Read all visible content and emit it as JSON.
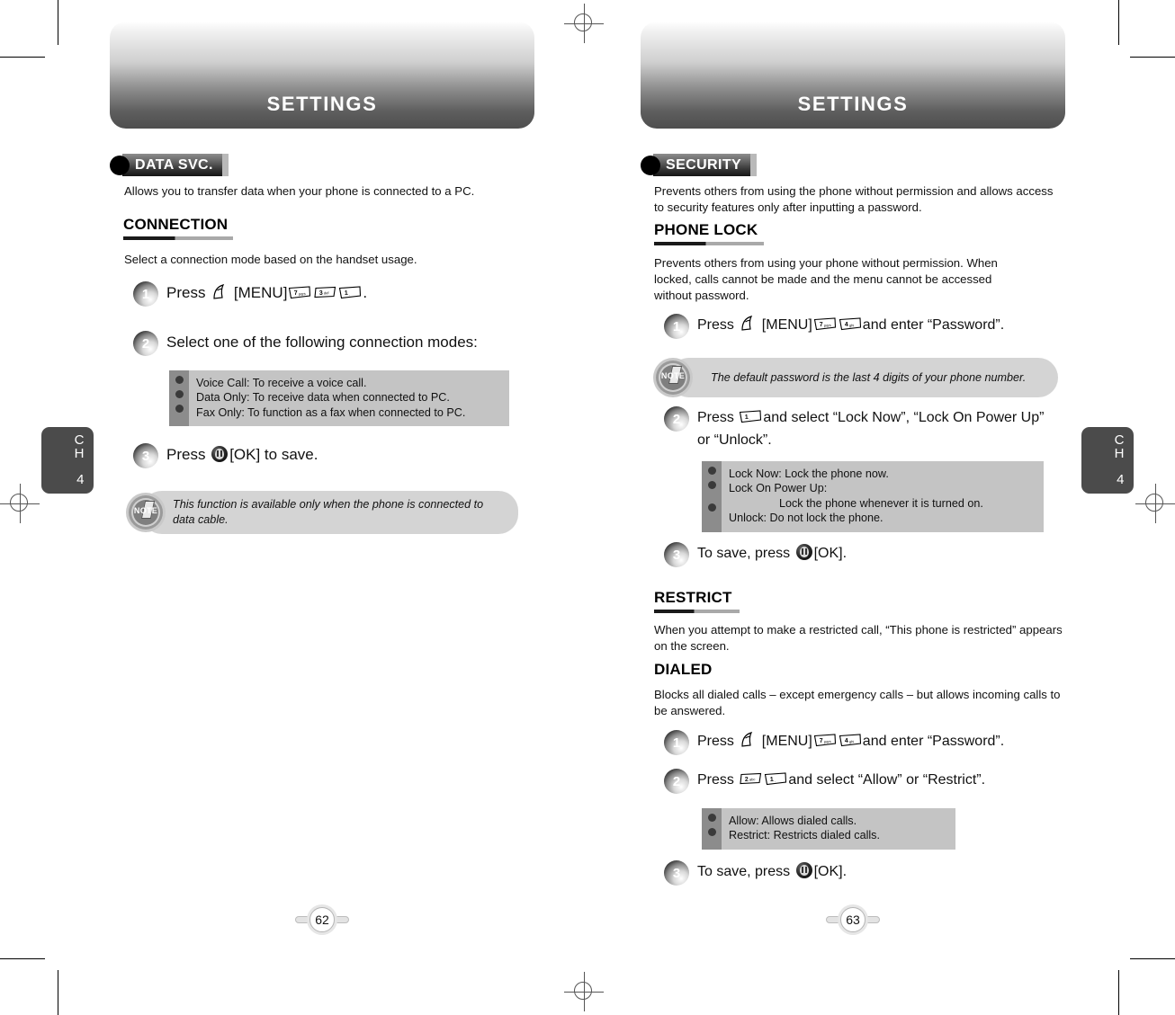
{
  "document": {
    "chapter_tab": {
      "line1": "C",
      "line2": "H",
      "line3": "4"
    }
  },
  "left_page": {
    "banner_title": "SETTINGS",
    "page_number": "62",
    "section": {
      "tag": "DATA SVC.",
      "intro": "Allows you to transfer data when your phone is connected to a PC."
    },
    "subsection": {
      "heading": "CONNECTION",
      "description": "Select a connection mode based on the handset usage."
    },
    "steps": [
      {
        "number": "1",
        "parts": [
          {
            "type": "text",
            "value": "Press "
          },
          {
            "type": "menu-key"
          },
          {
            "type": "text",
            "value": "[MENU]"
          },
          {
            "type": "key",
            "digit": "7",
            "letters": "pqrs"
          },
          {
            "type": "key",
            "digit": "3",
            "letters": "def"
          },
          {
            "type": "key",
            "digit": "1",
            "letters": "."
          },
          {
            "type": "text",
            "value": "."
          }
        ],
        "plain": "Press [MENU] 7 3 1 ."
      },
      {
        "number": "2",
        "plain": "Select one of the following connection modes:"
      },
      {
        "number": "3",
        "plain": "Press [OK] to save.",
        "before_ok": "Press ",
        "after_ok": "[OK] to save."
      }
    ],
    "info_box": {
      "bullets": [
        "Voice Call: To receive a voice call.",
        "Data Only: To receive data when connected to PC.",
        "Fax Only: To function as a fax when connected to PC."
      ]
    },
    "note": {
      "icon_label": "NOTE",
      "text": "This function is available only when the phone is connected to data cable."
    }
  },
  "right_page": {
    "banner_title": "SETTINGS",
    "page_number": "63",
    "section": {
      "tag": "SECURITY",
      "intro": "Prevents others from using the phone without permission and allows access to security features only after inputting a password."
    },
    "phone_lock": {
      "heading": "PHONE LOCK",
      "description": "Prevents others from using your phone without permission. When locked, calls cannot be made and the menu cannot be accessed without password.",
      "step1": {
        "number": "1",
        "before_menu": "Press ",
        "menu_label": "[MENU]",
        "keys": [
          {
            "digit": "7",
            "letters": "pqrs"
          },
          {
            "digit": "4",
            "letters": "ghi"
          }
        ],
        "after_keys": "and enter “Password”."
      },
      "note": {
        "icon_label": "NOTE",
        "text": "The default password is the last 4 digits of your phone number."
      },
      "step2": {
        "number": "2",
        "before_key": "Press ",
        "key": {
          "digit": "1",
          "letters": "."
        },
        "after_key": "and select “Lock Now”, “Lock On Power Up” or “Unlock”."
      },
      "info_box": {
        "bullets": [
          "Lock Now: Lock the phone now.",
          "Lock On Power Up:",
          "Unlock: Do not lock the phone."
        ],
        "indented_line": "Lock the phone whenever it is turned on."
      },
      "step3": {
        "number": "3",
        "before_ok": "To save, press ",
        "after_ok": "[OK]."
      }
    },
    "restrict": {
      "heading": "RESTRICT",
      "description": "When you attempt to make a restricted call, “This phone is restricted” appears on the screen."
    },
    "dialed": {
      "heading": "DIALED",
      "description": "Blocks all dialed calls – except emergency calls – but allows incoming calls to be answered.",
      "step1": {
        "number": "1",
        "before_menu": "Press ",
        "menu_label": "[MENU]",
        "keys": [
          {
            "digit": "7",
            "letters": "pqrs"
          },
          {
            "digit": "4",
            "letters": "ghi"
          }
        ],
        "after_keys": "and enter “Password”."
      },
      "step2": {
        "number": "2",
        "before_keys": "Press ",
        "keys": [
          {
            "digit": "2",
            "letters": "abc"
          },
          {
            "digit": "1",
            "letters": "."
          }
        ],
        "after_keys": "and select “Allow” or “Restrict”."
      },
      "info_box": {
        "bullets": [
          "Allow: Allows dialed calls.",
          "Restrict: Restricts dialed calls."
        ]
      },
      "step3": {
        "number": "3",
        "before_ok": "To save, press ",
        "after_ok": "[OK]."
      }
    }
  },
  "colors": {
    "banner_dark": "#4e4e4e",
    "tag_dark": "#151515",
    "infobox_body": "#c4c4c4",
    "infobox_strip": "#8c8c8c",
    "note_bg": "#d4d4d4",
    "chapter_tab": "#4b4b4b"
  }
}
